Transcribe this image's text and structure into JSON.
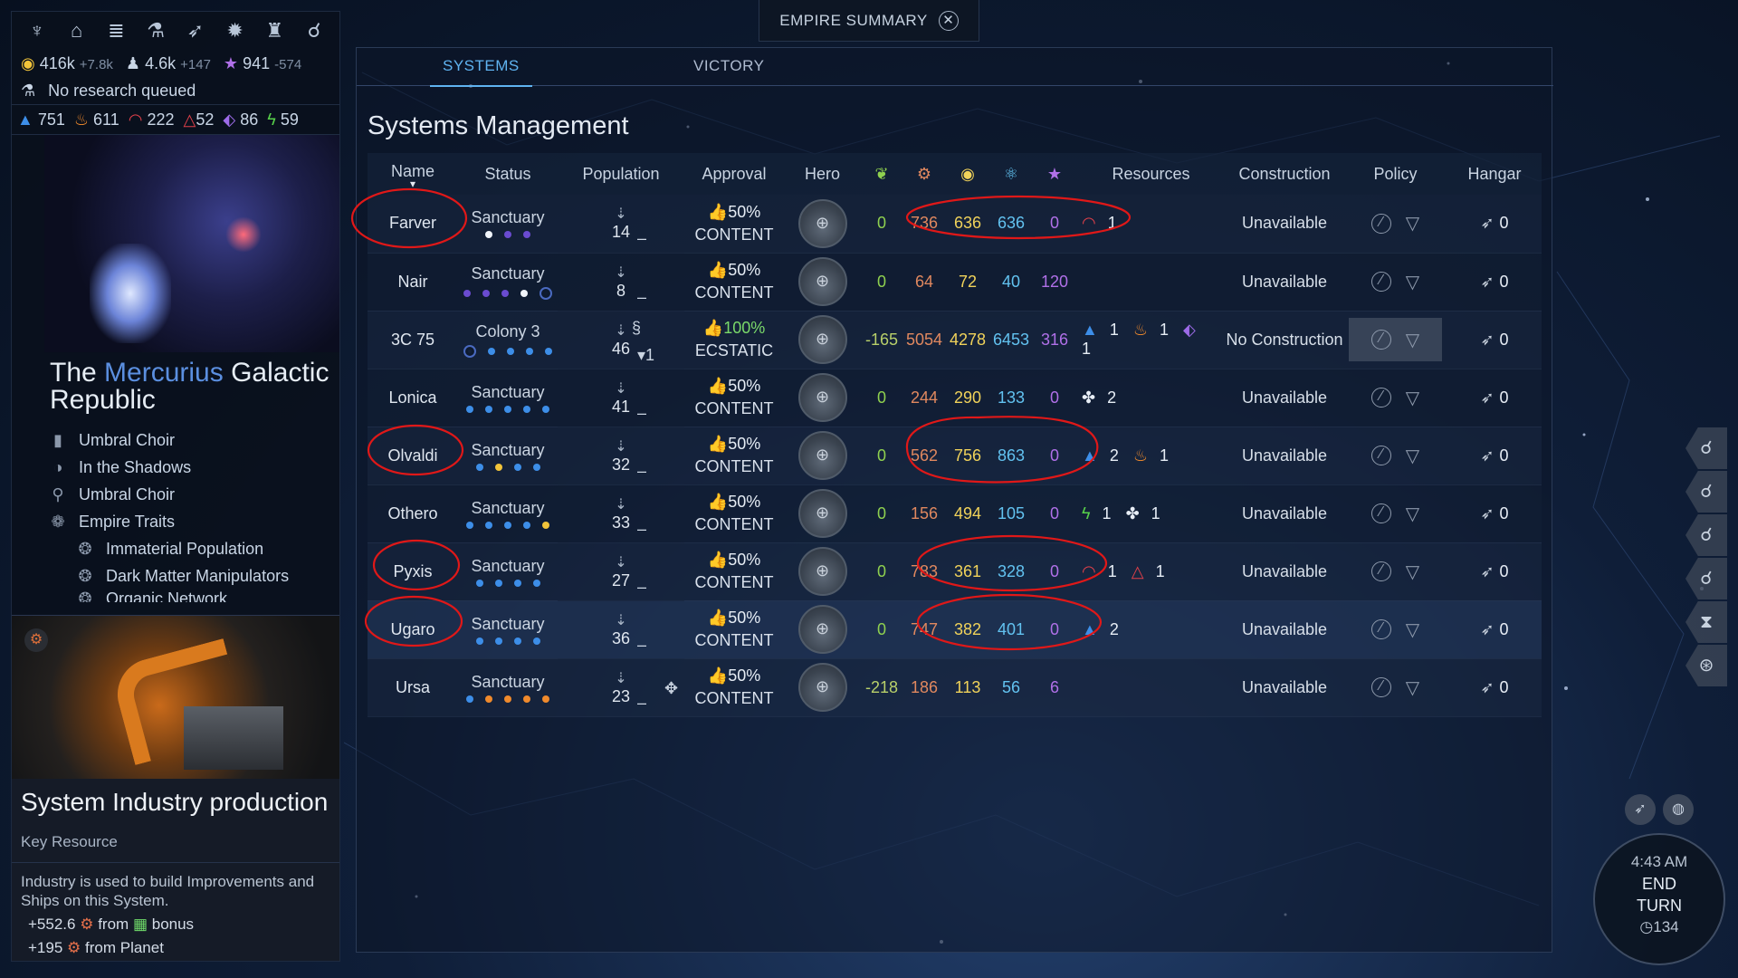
{
  "title": "EMPIRE SUMMARY",
  "tabs": [
    "SYSTEMS",
    "VICTORY"
  ],
  "heading": "Systems Management",
  "top_icons": [
    "faction-icon",
    "empire-icon",
    "trade-icon",
    "research-icon",
    "fleet-icon",
    "gear-icon",
    "trophy-icon",
    "diplomacy-icon"
  ],
  "top_stats": {
    "dust": "416k",
    "dust_delta": "+7.8k",
    "pop": "4.6k",
    "pop_delta": "+147",
    "influence": "941",
    "influence_delta": "-574"
  },
  "research_status": "No research queued",
  "strategic": [
    "751",
    "611",
    "222",
    "52",
    "86",
    "59"
  ],
  "empire": {
    "prefix": "The ",
    "name": "Mercurius",
    "suffix": " Galactic Republic",
    "traits": [
      "Umbral Choir",
      "In the Shadows",
      "Umbral Choir"
    ],
    "traits_heading": "Empire Traits",
    "trait_list": [
      "Immaterial Population",
      "Dark Matter Manipulators",
      "Organic Network"
    ]
  },
  "card": {
    "title": "System Industry production",
    "subtitle": "Key Resource",
    "desc": "Industry is used to build Improvements and Ships on this System.",
    "line1_val": "+552.6",
    "line1_from": "from",
    "line1_tail": "bonus",
    "line2_val": "+195",
    "line2_tail": "from Planet"
  },
  "columns": [
    "Name",
    "Status",
    "Population",
    "Approval",
    "Hero",
    "food-icon",
    "industry-icon",
    "dust-icon",
    "science-icon",
    "influence-icon",
    "Resources",
    "Construction",
    "Policy",
    "Hangar"
  ],
  "systems": [
    {
      "name": "Farver",
      "status": "Sanctuary",
      "pop": "14",
      "pop_extra": "–",
      "approval": "50%",
      "state": "CONTENT",
      "food": "0",
      "industry": "736",
      "dust": "636",
      "science": "636",
      "influence": "0",
      "resources": [
        [
          "red",
          "1"
        ]
      ],
      "construction": "Unavailable",
      "hangar": "0"
    },
    {
      "name": "Nair",
      "status": "Sanctuary",
      "pop": "8",
      "pop_extra": "–",
      "approval": "50%",
      "state": "CONTENT",
      "food": "0",
      "industry": "64",
      "dust": "72",
      "science": "40",
      "influence": "120",
      "resources": [],
      "construction": "Unavailable",
      "hangar": "0"
    },
    {
      "name": "3C 75",
      "status": "Colony 3",
      "pop": "46",
      "pop_extra": "▾1",
      "approval": "100%",
      "state": "ECSTATIC",
      "food": "-165",
      "industry": "5054",
      "dust": "4278",
      "science": "6453",
      "influence": "316",
      "resources": [
        [
          "blue",
          "1"
        ],
        [
          "org",
          "1"
        ],
        [
          "pur",
          "1"
        ]
      ],
      "construction": "No Construction",
      "hangar": "0"
    },
    {
      "name": "Lonica",
      "status": "Sanctuary",
      "pop": "41",
      "pop_extra": "–",
      "approval": "50%",
      "state": "CONTENT",
      "food": "0",
      "industry": "244",
      "dust": "290",
      "science": "133",
      "influence": "0",
      "resources": [
        [
          "wht",
          "2"
        ]
      ],
      "construction": "Unavailable",
      "hangar": "0"
    },
    {
      "name": "Olvaldi",
      "status": "Sanctuary",
      "pop": "32",
      "pop_extra": "–",
      "approval": "50%",
      "state": "CONTENT",
      "food": "0",
      "industry": "562",
      "dust": "756",
      "science": "863",
      "influence": "0",
      "resources": [
        [
          "blue",
          "2"
        ],
        [
          "org",
          "1"
        ]
      ],
      "construction": "Unavailable",
      "hangar": "0"
    },
    {
      "name": "Othero",
      "status": "Sanctuary",
      "pop": "33",
      "pop_extra": "–",
      "approval": "50%",
      "state": "CONTENT",
      "food": "0",
      "industry": "156",
      "dust": "494",
      "science": "105",
      "influence": "0",
      "resources": [
        [
          "grn",
          "1"
        ],
        [
          "wht",
          "1"
        ]
      ],
      "construction": "Unavailable",
      "hangar": "0"
    },
    {
      "name": "Pyxis",
      "status": "Sanctuary",
      "pop": "27",
      "pop_extra": "–",
      "approval": "50%",
      "state": "CONTENT",
      "food": "0",
      "industry": "783",
      "dust": "361",
      "science": "328",
      "influence": "0",
      "resources": [
        [
          "red",
          "1"
        ],
        [
          "red2",
          "1"
        ]
      ],
      "construction": "Unavailable",
      "hangar": "0"
    },
    {
      "name": "Ugaro",
      "status": "Sanctuary",
      "pop": "36",
      "pop_extra": "–",
      "approval": "50%",
      "state": "CONTENT",
      "food": "0",
      "industry": "747",
      "dust": "382",
      "science": "401",
      "influence": "0",
      "resources": [
        [
          "blue",
          "2"
        ]
      ],
      "construction": "Unavailable",
      "hangar": "0"
    },
    {
      "name": "Ursa",
      "status": "Sanctuary",
      "pop": "23",
      "pop_extra": "–",
      "approval": "50%",
      "state": "CONTENT",
      "food": "-218",
      "industry": "186",
      "dust": "113",
      "science": "56",
      "influence": "6",
      "resources": [],
      "construction": "Unavailable",
      "hangar": "0"
    }
  ],
  "end_turn": {
    "time": "4:43 AM",
    "label1": "END",
    "label2": "TURN",
    "turn": "134"
  },
  "colors": {
    "accent": "#5fb3f0",
    "food": "#8fd14f",
    "industry": "#e0885f",
    "dust": "#f0d25a",
    "science": "#62c2f0",
    "influence": "#b070e8",
    "annotation": "#e01818"
  }
}
